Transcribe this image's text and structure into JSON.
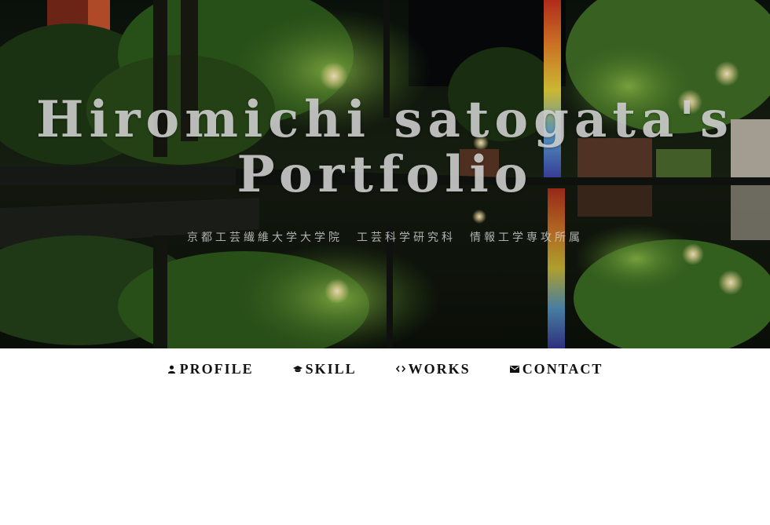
{
  "hero": {
    "title_line1": "Hiromichi satogata's",
    "title_line2": "Portfolio",
    "subtitle": "京都工芸繊維大学大学院　工芸科学研究科　情報工学専攻所属"
  },
  "nav": {
    "items": [
      {
        "label": "PROFILE",
        "icon": "person-icon"
      },
      {
        "label": "SKILL",
        "icon": "graduation-cap-icon"
      },
      {
        "label": "WORKS",
        "icon": "code-icon"
      },
      {
        "label": "CONTACT",
        "icon": "envelope-icon"
      }
    ]
  }
}
